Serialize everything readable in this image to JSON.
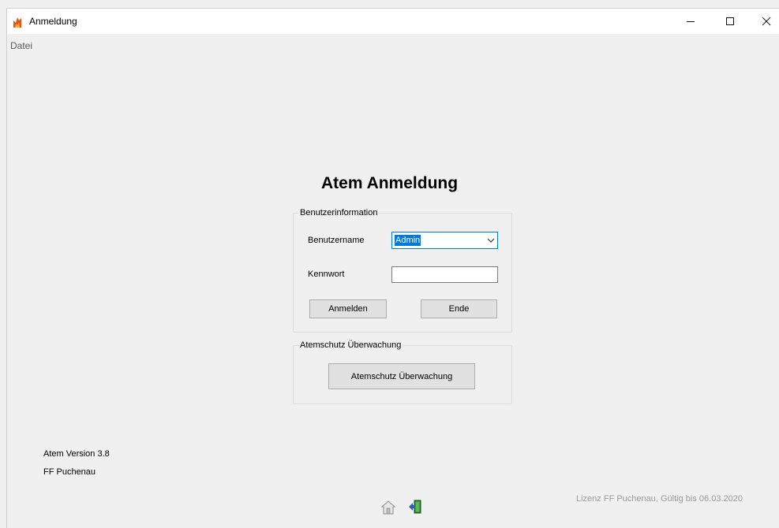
{
  "window": {
    "title": "Anmeldung",
    "minimize_glyph": "—",
    "maximize_glyph": "☐",
    "close_glyph": "✕"
  },
  "menu": {
    "items": [
      {
        "label": "Datei"
      }
    ]
  },
  "heading": "Atem Anmeldung",
  "login_group": {
    "legend": "Benutzerinformation",
    "username_label": "Benutzername",
    "username_value": "Admin",
    "password_label": "Kennwort",
    "password_value": "",
    "login_button": "Anmelden",
    "exit_button": "Ende"
  },
  "monitor_group": {
    "legend": "Atemschutz Überwachung",
    "button": "Atemschutz Überwachung"
  },
  "footer": {
    "version": "Atem Version 3.8",
    "organization": "FF Puchenau",
    "license": "Lizenz FF Puchenau, Gültig bis 06.03.2020"
  },
  "icons": [
    "flame-app-icon",
    "home-icon",
    "exit-door-icon",
    "chevron-down-icon"
  ],
  "colors": {
    "selection": "#0078d7",
    "background": "#f0f0f0",
    "button": "#e1e1e1"
  }
}
